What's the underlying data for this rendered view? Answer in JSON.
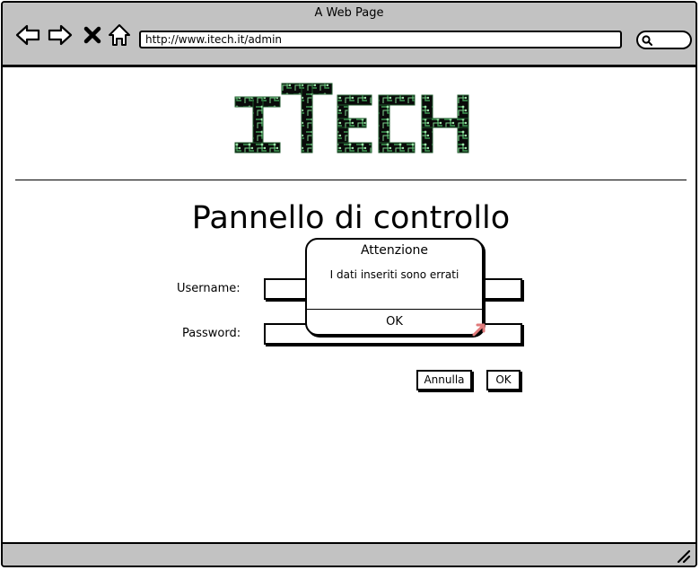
{
  "browser": {
    "title": "A Web Page",
    "url": "http://www.itech.it/admin",
    "nav_icons": [
      "back-arrow-icon",
      "forward-arrow-icon",
      "stop-icon",
      "home-icon"
    ],
    "search_icon": "search-icon"
  },
  "logo": {
    "text": "ITECH",
    "color": "#1f5a2c"
  },
  "page": {
    "title": "Pannello di controllo",
    "username_label": "Username:",
    "username_value": "",
    "password_label": "Password:",
    "password_value": "",
    "cancel_label": "Annulla",
    "ok_label": "OK"
  },
  "dialog": {
    "title": "Attenzione",
    "message": "I dati inseriti sono errati",
    "ok_label": "OK"
  },
  "colors": {
    "chrome": "#c2c2c2",
    "cursor": "#e07a7a"
  }
}
